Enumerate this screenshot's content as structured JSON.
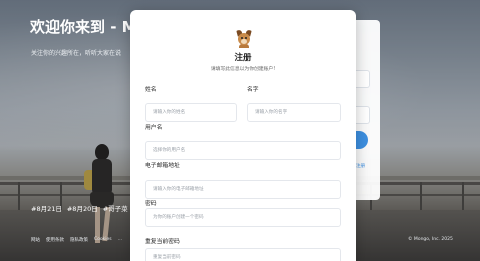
{
  "hero": {
    "title": "欢迎你来到 - M",
    "subtitle": "关注你的兴趣所在，听听大家在说"
  },
  "tags": [
    "#8月21日",
    "#8月20日",
    "#哥子菜",
    "#"
  ],
  "footer": {
    "links": [
      "网站",
      "使用条款",
      "隐私政策",
      "Cookies",
      "…"
    ],
    "copyright": "© Mongo, Inc. 2025"
  },
  "side_panel": {
    "link_label": "注册"
  },
  "modal": {
    "title": "注册",
    "subtitle": "请填写此信息以为你创建账户!",
    "fields": {
      "last_name": {
        "label": "姓名",
        "placeholder": "请输入你的姓名"
      },
      "first_name": {
        "label": "名字",
        "placeholder": "请输入你的名字"
      },
      "username": {
        "label": "用户名",
        "placeholder": "选择你的用户名"
      },
      "email": {
        "label": "电子邮箱地址",
        "placeholder": "请输入你的电子邮箱地址"
      },
      "password": {
        "label": "密码",
        "placeholder": "为你的账户创建一个密码"
      },
      "confirm_password": {
        "label": "重复当前密码",
        "placeholder": "重复当前密码"
      }
    }
  }
}
